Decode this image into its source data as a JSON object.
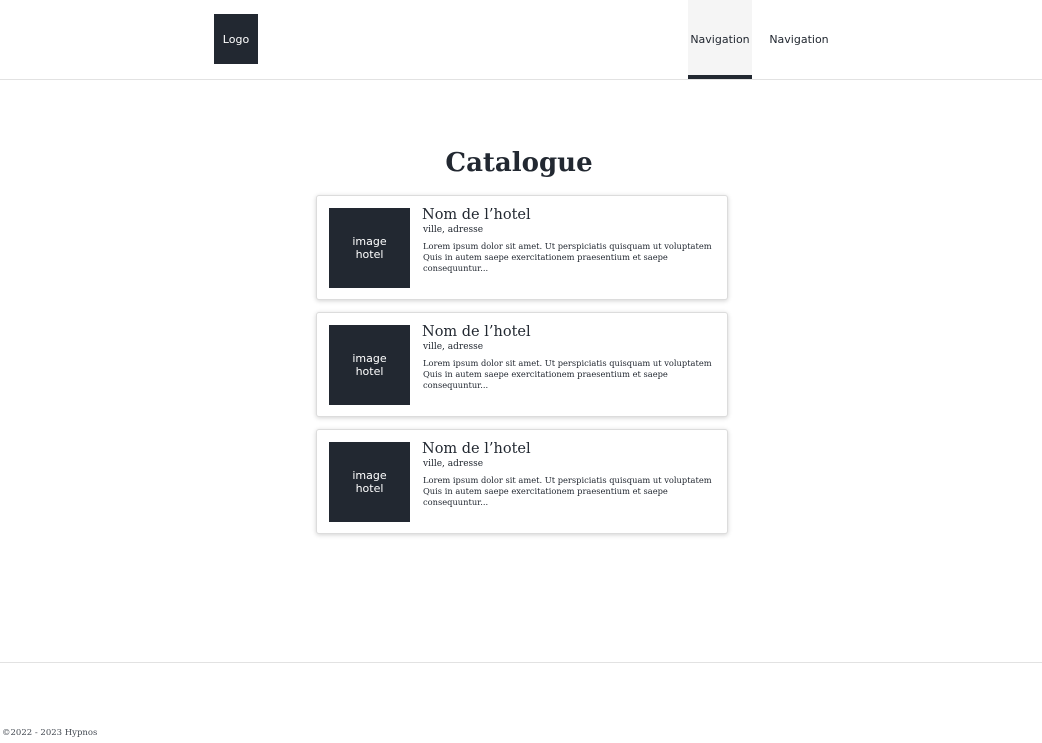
{
  "header": {
    "logo_label": "Logo",
    "nav": [
      {
        "label": "Navigation",
        "active": true
      },
      {
        "label": "Navigation",
        "active": false
      }
    ]
  },
  "main": {
    "title": "Catalogue",
    "hotels": [
      {
        "image_label": "image\nhotel",
        "name": "Nom de l’hotel",
        "address": "ville, adresse",
        "description": "Lorem ipsum dolor sit amet. Ut perspiciatis quisquam ut voluptatem Quis in autem saepe exercitationem praesentium et saepe consequuntur..."
      },
      {
        "image_label": "image\nhotel",
        "name": "Nom de l’hotel",
        "address": "ville, adresse",
        "description": "Lorem ipsum dolor sit amet. Ut perspiciatis quisquam ut voluptatem Quis in autem saepe exercitationem praesentium et saepe consequuntur..."
      },
      {
        "image_label": "image\nhotel",
        "name": "Nom de l’hotel",
        "address": "ville, adresse",
        "description": "Lorem ipsum dolor sit amet. Ut perspiciatis quisquam ut voluptatem Quis in autem saepe exercitationem praesentium et saepe consequuntur..."
      }
    ]
  },
  "footer": {
    "copyright": "©2022 - 2023 Hypnos"
  },
  "colors": {
    "primary_dark": "#222831",
    "nav_active_bg": "#f5f5f5",
    "background": "#ffffff",
    "border": "#e2e2e2"
  }
}
